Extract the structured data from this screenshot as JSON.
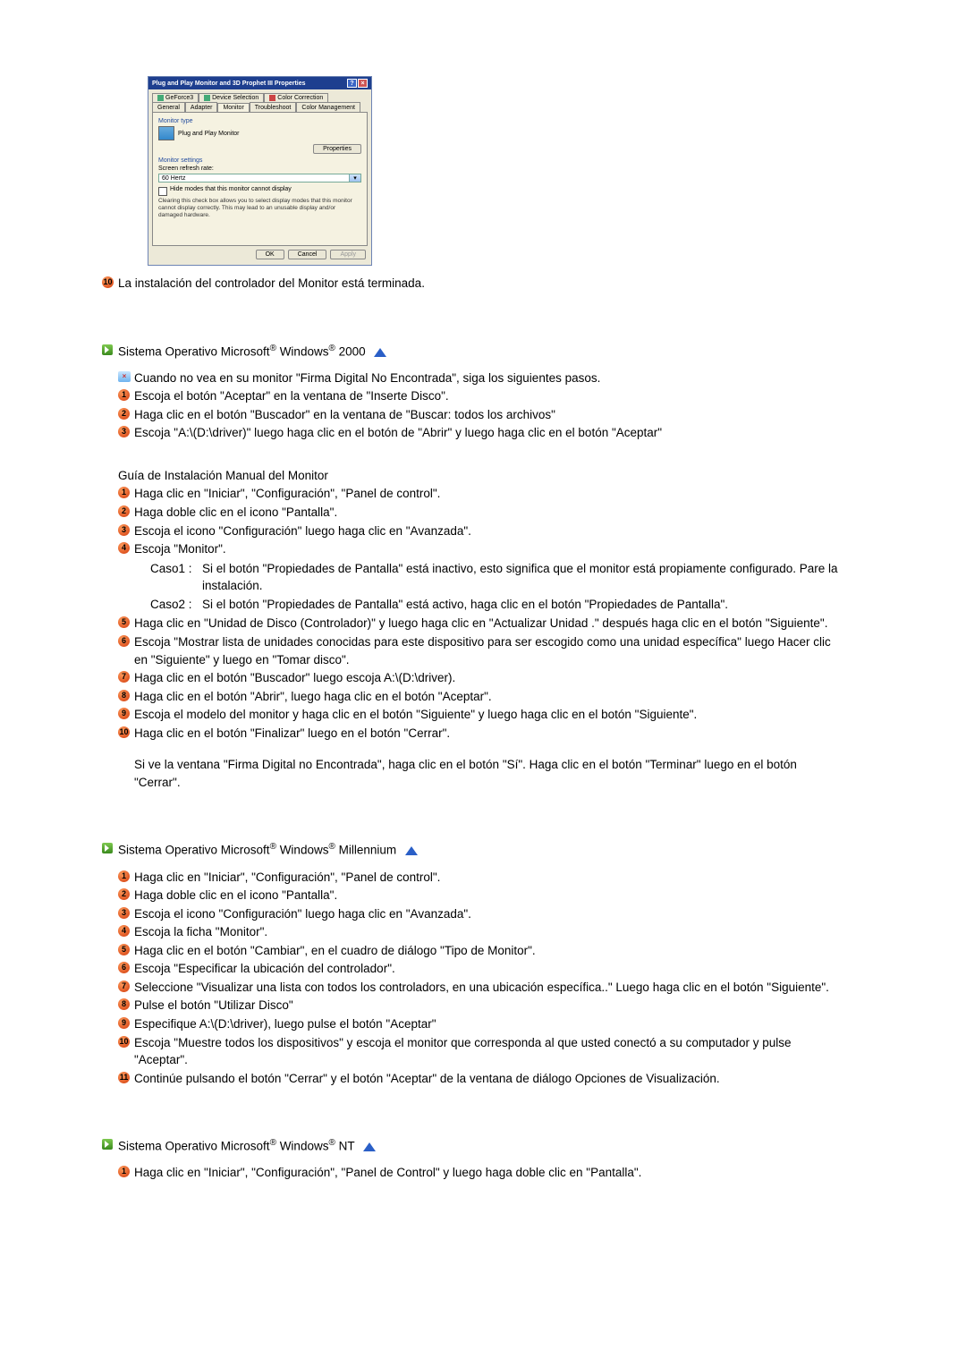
{
  "dialog": {
    "title": "Plug and Play Monitor and 3D Prophet III Properties",
    "tabs_row1": [
      {
        "label": "GeForce3",
        "icon": true
      },
      {
        "label": "Device Selection",
        "icon": true
      },
      {
        "label": "Color Correction",
        "iconRed": true
      }
    ],
    "tabs_row2": [
      {
        "label": "General"
      },
      {
        "label": "Adapter"
      },
      {
        "label": "Monitor",
        "active": true
      },
      {
        "label": "Troubleshoot"
      },
      {
        "label": "Color Management"
      }
    ],
    "monitor_type_label": "Monitor type",
    "monitor_name": "Plug and Play Monitor",
    "properties_btn": "Properties",
    "monitor_settings_label": "Monitor settings",
    "refresh_label": "Screen refresh rate:",
    "refresh_value": "60 Hertz",
    "hide_modes": "Hide modes that this monitor cannot display",
    "hide_hint": "Clearing this check box allows you to select display modes that this monitor cannot display correctly. This may lead to an unusable display and/or damaged hardware.",
    "ok": "OK",
    "cancel": "Cancel",
    "apply": "Apply"
  },
  "line_install_finished": "La instalación del controlador del Monitor está terminada.",
  "sections": {
    "win2000": {
      "heading_pre": "Sistema Operativo Microsoft",
      "heading_mid": " Windows",
      "heading_post": " 2000",
      "info_line": "Cuando no vea en su monitor \"Firma Digital No Encontrada\", siga los siguientes pasos.",
      "steps_a": [
        "Escoja el botón \"Aceptar\" en la ventana de \"Inserte Disco\".",
        "Haga clic en el botón \"Buscador\" en la ventana de \"Buscar: todos los archivos\"",
        "Escoja \"A:\\(D:\\driver)\" luego haga clic en el botón de \"Abrir\" y luego haga clic en el botón \"Aceptar\""
      ],
      "guide_heading": "Guía de Instalación Manual del Monitor",
      "steps_b": [
        "Haga clic en \"Iniciar\", \"Configuración\", \"Panel de control\".",
        "Haga doble clic en el icono \"Pantalla\".",
        "Escoja el icono \"Configuración\" luego haga clic en \"Avanzada\".",
        "Escoja \"Monitor\"."
      ],
      "caso1_label": "Caso1 :",
      "caso1_text": "Si el botón \"Propiedades de Pantalla\" está inactivo, esto significa que el monitor está propiamente configurado. Pare la instalación.",
      "caso2_label": "Caso2 :",
      "caso2_text": "Si el botón \"Propiedades de Pantalla\" está activo, haga clic en el botón \"Propiedades de Pantalla\".",
      "steps_c": [
        "Haga clic en \"Unidad de Disco (Controlador)\" y luego haga clic en \"Actualizar Unidad .\" después haga clic en el botón \"Siguiente\".",
        "Escoja \"Mostrar lista de unidades conocidas para este dispositivo para ser escogido como una unidad específica\" luego Hacer clic en \"Siguiente\" y luego en \"Tomar disco\".",
        "Haga clic en el botón \"Buscador\" luego escoja A:\\(D:\\driver).",
        "Haga clic en el botón \"Abrir\", luego haga clic en el botón \"Aceptar\".",
        "Escoja el modelo del monitor y haga clic en el botón \"Siguiente\" y luego haga clic en el botón \"Siguiente\".",
        "Haga clic en el botón \"Finalizar\" luego en el botón \"Cerrar\"."
      ],
      "note": "Si ve la ventana \"Firma Digital no Encontrada\", haga clic en el botón \"Sí\". Haga clic en el botón \"Terminar\" luego en el botón \"Cerrar\"."
    },
    "winme": {
      "heading_pre": "Sistema Operativo Microsoft",
      "heading_mid": " Windows",
      "heading_post": " Millennium",
      "steps": [
        "Haga clic en \"Iniciar\", \"Configuración\", \"Panel de control\".",
        "Haga doble clic en el icono \"Pantalla\".",
        "Escoja el icono \"Configuración\" luego haga clic en \"Avanzada\".",
        "Escoja la ficha \"Monitor\".",
        "Haga clic en el botón \"Cambiar\", en el cuadro de diálogo \"Tipo de Monitor\".",
        "Escoja \"Especificar la ubicación del controlador\".",
        "Seleccione \"Visualizar una lista con todos los controladors, en una ubicación específica..\" Luego haga clic en el botón \"Siguiente\".",
        "Pulse el botón \"Utilizar Disco\"",
        "Especifique A:\\(D:\\driver), luego pulse el botón \"Aceptar\"",
        "Escoja \"Muestre todos los dispositivos\" y escoja el monitor que corresponda al que usted conectó a su computador y pulse \"Aceptar\".",
        "Continúe pulsando el botón \"Cerrar\" y el botón \"Aceptar\" de la ventana de diálogo Opciones de Visualización."
      ]
    },
    "winnt": {
      "heading_pre": "Sistema Operativo Microsoft",
      "heading_mid": " Windows",
      "heading_post": " NT",
      "steps": [
        "Haga clic en \"Iniciar\", \"Configuración\", \"Panel de Control\" y luego haga doble clic en \"Pantalla\"."
      ]
    }
  }
}
